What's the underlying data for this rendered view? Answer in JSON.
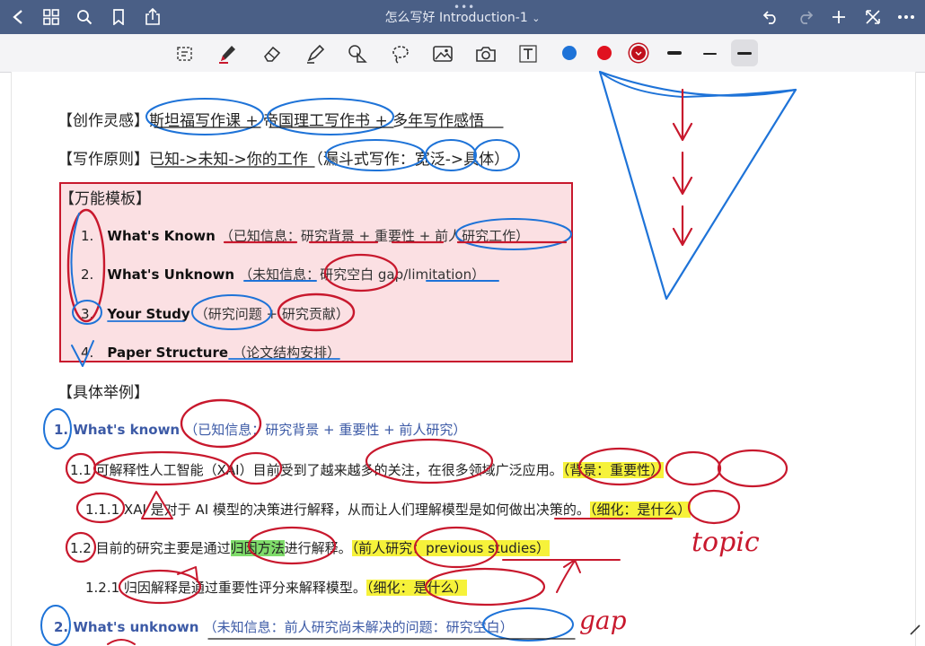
{
  "app": {
    "doc_title": "怎么写好 Introduction-1",
    "nav": {
      "back": "chevron-left-icon",
      "grid": "grid-icon",
      "search": "search-icon",
      "bookmark": "bookmark-icon",
      "share": "share-icon"
    },
    "actions": [
      "undo-icon",
      "redo-icon",
      "add-icon",
      "fullscreen-icon",
      "more-icon"
    ]
  },
  "toolbar": {
    "tools": [
      "lasso-select-icon",
      "pen-icon",
      "eraser-icon",
      "highlighter-icon",
      "shapes-icon",
      "lasso-icon",
      "image-icon",
      "camera-icon",
      "text-icon"
    ],
    "colors": [
      "#1e73d8",
      "#e0121f",
      "#c0101c"
    ],
    "stroke_widths": [
      "thick",
      "thin",
      "medium"
    ]
  },
  "content": {
    "line_inspiration": "【创作灵感】斯坦福写作课 + 帝国理工写作书 + 多年写作感悟",
    "line_principle": "【写作原则】已知->未知->你的工作（漏斗式写作：宽泛->具体）",
    "template": {
      "title": "【万能模板】",
      "items": [
        {
          "num": "1.",
          "en": "What's Known",
          "zh": "（已知信息：研究背景 + 重要性 + 前人研究工作）"
        },
        {
          "num": "2.",
          "en": "What's Unknown",
          "zh": "（未知信息：研究空白 gap/limitation）"
        },
        {
          "num": "3.",
          "en": "Your Study",
          "zh": "（研究问题 + 研究贡献）"
        },
        {
          "num": "4.",
          "en": "Paper Structure",
          "zh": "（论文结构安排）"
        }
      ]
    },
    "example_title": "【具体举例】",
    "ex1": {
      "en": "1. What's known",
      "zh": "（已知信息：研究背景 + 重要性 + 前人研究）"
    },
    "ex1_1": {
      "text": "1.1 可解释性人工智能（XAI）目前受到了越来越多的关注，在很多领域广泛应用。",
      "tag": "（背景：重要性）"
    },
    "ex1_1_1": {
      "text": "1.1.1 XAI 是对于 AI 模型的决策进行解释，从而让人们理解模型是如何做出决策的。",
      "tag": "（细化：是什么）"
    },
    "ex1_2": {
      "pre": "1.2 目前的研究主要是通过",
      "green": "归因方法",
      "post": "进行解释。",
      "tag_a": "（前人研究：",
      "tag_b": "previous studies）"
    },
    "ex1_2_1": {
      "text": "1.2.1 归因解释是通过重要性评分来解释模型。",
      "tag": "（细化：是什么）"
    },
    "ex2": {
      "en": "2. What's unknown",
      "zh": "（未知信息：前人研究尚未解决的问题：研究空白）"
    },
    "hand_topic": "topic",
    "hand_gap": "gap"
  }
}
